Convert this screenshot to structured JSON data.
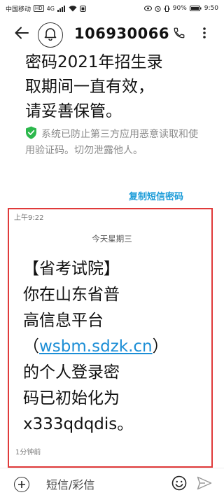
{
  "status_bar": {
    "carrier": "中国移动",
    "network_badge": "HD",
    "network_type": "4G",
    "battery": "90%",
    "time": "9:50"
  },
  "header": {
    "contact": "106930066"
  },
  "previous_message": {
    "lines": [
      "密码2021年招生录",
      "取期间一直有效，",
      "请妥善保管。"
    ]
  },
  "security_note": {
    "text": "系统已防止第三方应用恶意读取和使用验证码。切勿泄露他人。"
  },
  "copy_link": {
    "label": "复制短信密码"
  },
  "message": {
    "time": "上午9:22",
    "day_label": "今天星期三",
    "lines": [
      "【省考试院】",
      "你在山东省普",
      "高信息平台",
      "的个人登录密",
      "码已初始化为",
      "x333qdqdis。"
    ],
    "link_open": "（",
    "link_text": "wsbm.sdzk.cn",
    "link_close": "）",
    "ago": "1分钟前"
  },
  "composer": {
    "placeholder": "短信/彩信"
  },
  "colors": {
    "link": "#1c8ed6",
    "highlight_border": "#e03a3a",
    "shield_green": "#2db84d"
  },
  "icons": [
    "back-arrow-icon",
    "notification-bell-icon",
    "phone-icon",
    "more-vertical-icon",
    "shield-check-icon",
    "add-icon",
    "emoji-icon",
    "send-icon"
  ]
}
